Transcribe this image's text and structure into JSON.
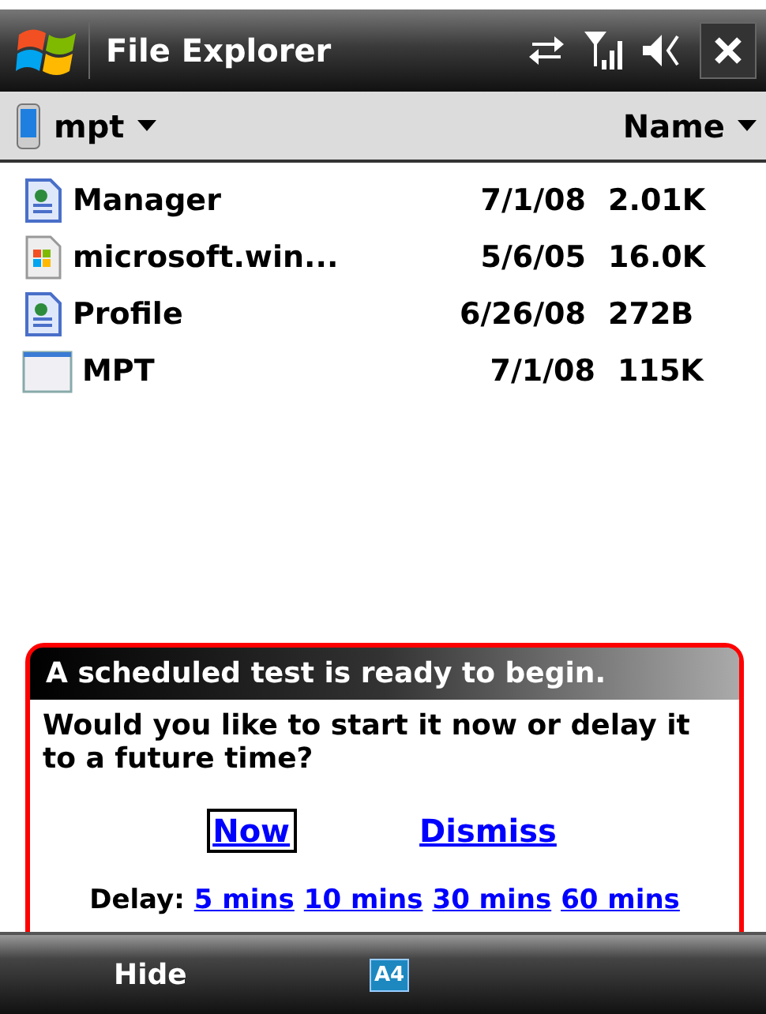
{
  "window": {
    "title": "File Explorer"
  },
  "folder_bar": {
    "folder": "mpt",
    "sort": "Name"
  },
  "files": [
    {
      "kind": "document",
      "name": "Manager",
      "date": "7/1/08",
      "size": "2.01K"
    },
    {
      "kind": "app",
      "name": "microsoft.win...",
      "date": "5/6/05",
      "size": "16.0K"
    },
    {
      "kind": "document",
      "name": "Profile",
      "date": "6/26/08",
      "size": "272B"
    },
    {
      "kind": "blank",
      "name": "MPT",
      "date": "7/1/08",
      "size": "115K"
    }
  ],
  "notification": {
    "title": "A scheduled test is ready to begin.",
    "message": "Would you like to start it now or delay it to a future time?",
    "actions": [
      {
        "label": "Now",
        "focused": true
      },
      {
        "label": "Dismiss",
        "focused": false
      }
    ],
    "delay_label": "Delay:",
    "delay_options": [
      "5 mins",
      "10 mins",
      "30 mins",
      "60 mins"
    ]
  },
  "softkey_bar": {
    "left": "Hide",
    "input_indicator": "A4"
  }
}
